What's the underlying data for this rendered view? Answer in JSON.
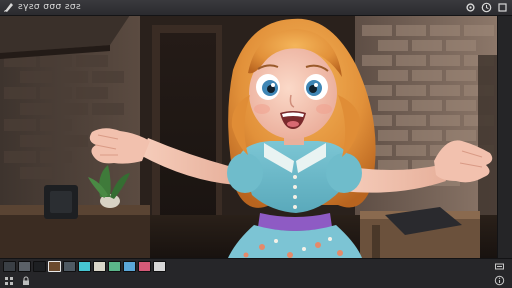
{
  "app": {
    "title": "ƨγƨσ σσσ ƨσƨ"
  },
  "toolbar": {
    "left_icon": "brush-icon",
    "right_icons": [
      "settings-icon",
      "clock-icon",
      "expand-icon"
    ]
  },
  "palette": {
    "swatches": [
      "#3a3f45",
      "#5b6168",
      "#1d1f22",
      "#6b4a2e",
      "#4f5a63",
      "#46c6d2",
      "#d9d6c8",
      "#5bb58a",
      "#5aa7d8",
      "#d45a78",
      "#d7d7d7"
    ],
    "active_index": 3
  },
  "status": {
    "icons": [
      "grid-icon",
      "lock-icon"
    ]
  },
  "colors": {
    "hair": "#e59a3c",
    "dress": "#65b8c8",
    "belt": "#8e5bc4",
    "skin": "#f1c6b4",
    "wall": "#7b6558",
    "chrome": "#2b2b2f"
  }
}
